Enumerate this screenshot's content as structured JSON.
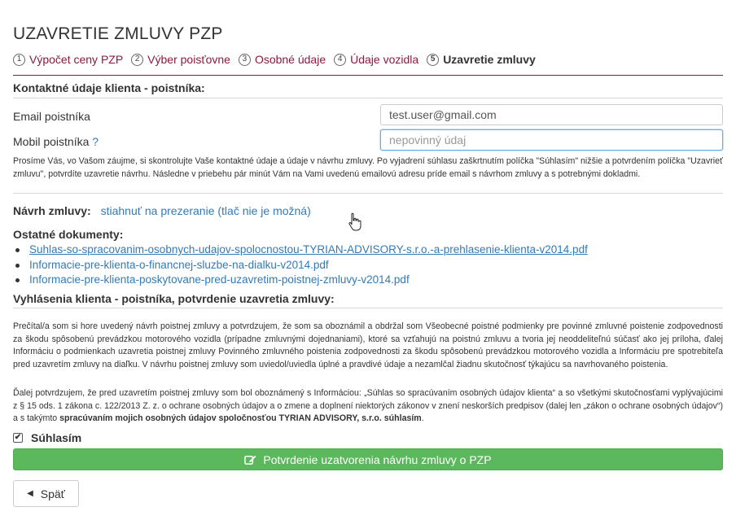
{
  "page": {
    "title": "UZAVRETIE ZMLUVY PZP"
  },
  "steps": [
    {
      "num": "1",
      "label": "Výpočet ceny PZP"
    },
    {
      "num": "2",
      "label": "Výber poisťovne"
    },
    {
      "num": "3",
      "label": "Osobné údaje"
    },
    {
      "num": "4",
      "label": "Údaje vozidla"
    },
    {
      "num": "5",
      "label": "Uzavretie zmluvy",
      "active": true
    }
  ],
  "contact": {
    "heading": "Kontaktné údaje klienta - poistníka:",
    "email_label": "Email poistníka",
    "email_value": "test.user@gmail.com",
    "mobile_label": "Mobil poistníka",
    "mobile_help": "?",
    "mobile_placeholder": "nepovinný údaj",
    "notice": "Prosíme Vás, vo Vašom záujme, si skontrolujte Vaše kontaktné údaje a údaje v návrhu zmluvy. Po vyjadrení súhlasu zaškrtnutím políčka \"Súhlasím\" nižšie a potvrdením políčka \"Uzavrieť zmluvu\", potvrdíte uzavretie návrhu. Následne v priebehu pár minút Vám na Vami uvedenú emailovú adresu príde email s návrhom zmluvy a s potrebnými dokladmi."
  },
  "proposal": {
    "label": "Návrh zmluvy:",
    "link": "stiahnuť na prezeranie (tlač nie je možná)"
  },
  "documents": {
    "heading": "Ostatné dokumenty:",
    "items": [
      "Suhlas-so-spracovanim-osobnych-udajov-spolocnostou-TYRIAN-ADVISORY-s.r.o.-a-prehlasenie-klienta-v2014.pdf",
      "Informacie-pre-klienta-o-financnej-sluzbe-na-dialku-v2014.pdf",
      "Informacie-pre-klienta-poskytovane-pred-uzavretim-poistnej-zmluvy-v2014.pdf"
    ]
  },
  "declarations": {
    "heading": "Vyhlásenia klienta - poistníka, potvrdenie uzavretia zmluvy:",
    "paragraph1": "Prečítal/a som si hore uvedený návrh poistnej zmluvy a potvrdzujem, že som sa oboznámil a obdržal som Všeobecné poistné podmienky pre povinné zmluvné poistenie zodpovednosti za škodu spôsobenú prevádzkou motorového vozidla (prípadne zmluvnými dojednaniami), ktoré sa vzťahujú na poistnú zmluvu a tvoria jej neoddeliteľnú súčasť ako jej príloha, ďalej Informáciu o podmienkach uzavretia poistnej zmluvy Povinného zmluvného poistenia zodpovednosti za škodu spôsobenú prevádzkou motorového vozidla a Informáciu pre spotrebiteľa pred uzavretím zmluvy na diaľku. V návrhu poistnej zmluvy som uviedol/uviedla úplné a pravdivé údaje a nezamlčal žiadnu skutočnosť týkajúcu sa navrhovaného poistenia.",
    "paragraph2_start": "Ďalej potvrdzujem, že pred uzavretím poistnej zmluvy som bol oboznámený s Informáciou: „Súhlas so spracúvaním osobných údajov klienta“ a so všetkými skutočnosťami vyplývajúcimi z § 15 ods. 1 zákona c. 122/2013 Z. z. o ochrane osobných údajov a o zmene a doplnení niektorých zákonov v znení neskorších predpisov (dalej len „zákon o ochrane osobných údajov“) a s takýmto ",
    "paragraph2_bold": "spracúvaním mojich osobných údajov spoločnosťou TYRIAN ADVISORY, s.r.o. súhlasím",
    "paragraph2_end": "."
  },
  "agree": {
    "label": "Súhlasím",
    "checked": true,
    "check_mark": "✔"
  },
  "buttons": {
    "confirm": "Potvrdenie uzatvorenia návrhu zmluvy o PZP",
    "back": "Späť",
    "back_icon": "◀"
  },
  "colors": {
    "accent": "#8b1a3c",
    "link": "#337ab7",
    "success": "#5cb85c"
  },
  "icons": {
    "confirm": "edit-icon",
    "back": "caret-left-icon",
    "cursor": "hand-pointer-icon"
  }
}
